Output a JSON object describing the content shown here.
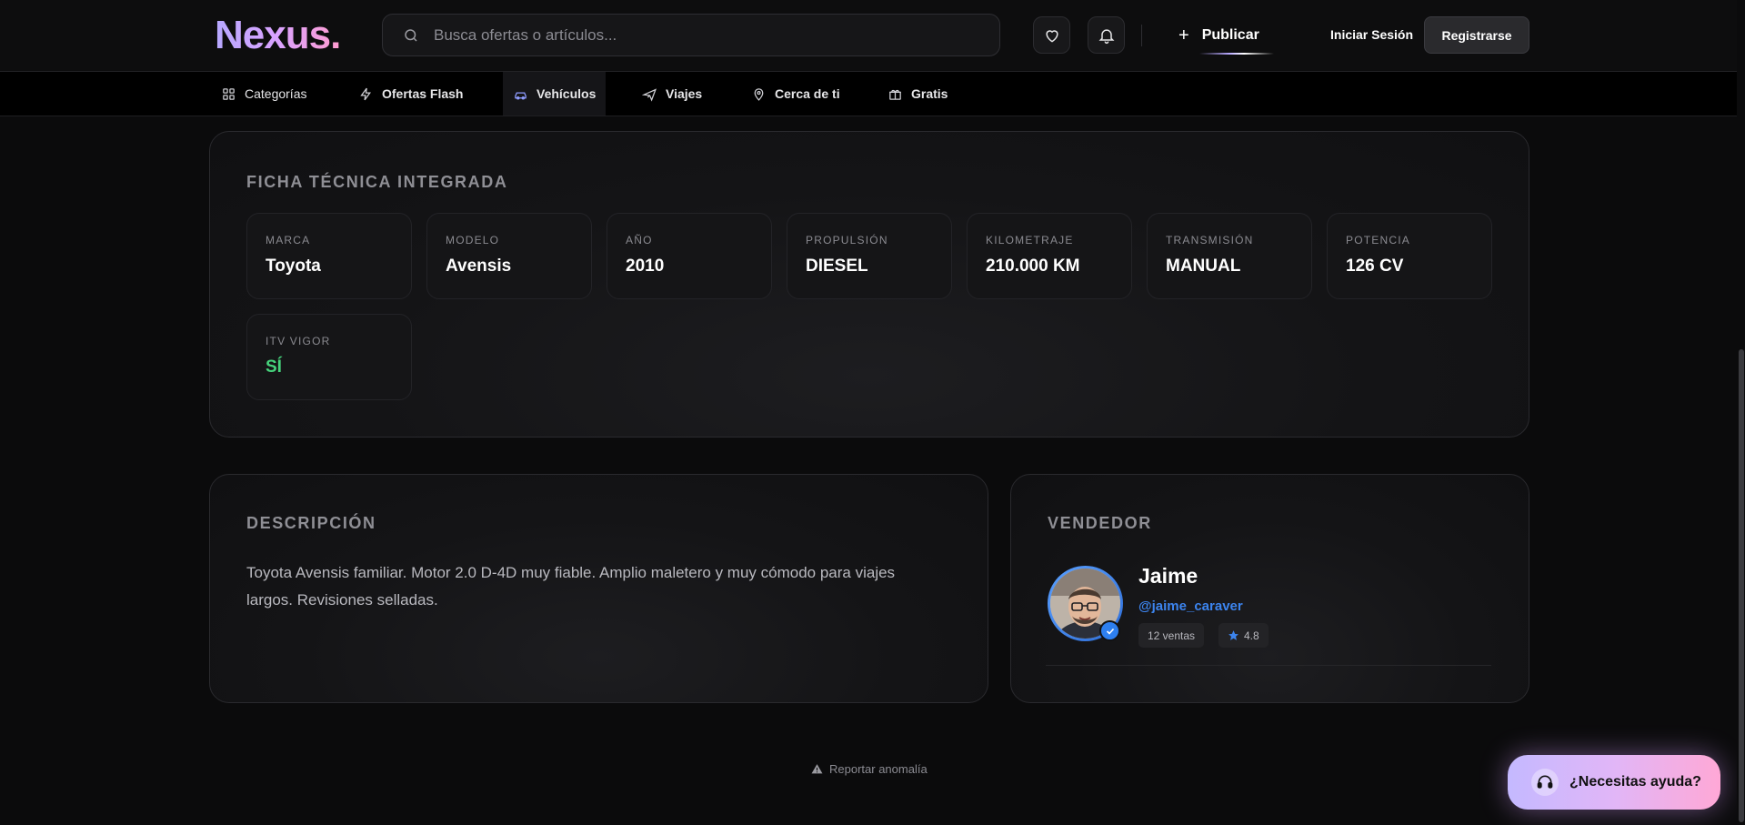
{
  "header": {
    "logo": "Nexus.",
    "search_placeholder": "Busca ofertas o artículos...",
    "favorites_icon": "heart-icon",
    "notifications_icon": "bell-icon",
    "publish_label": "Publicar",
    "login_label": "Iniciar Sesión",
    "register_label": "Registrarse"
  },
  "categories": [
    {
      "label": "Categorías",
      "icon": "grid-icon"
    },
    {
      "label": "Ofertas Flash",
      "icon": "lightning-icon"
    },
    {
      "label": "Vehículos",
      "icon": "car-icon",
      "active": true
    },
    {
      "label": "Viajes",
      "icon": "plane-icon"
    },
    {
      "label": "Cerca de ti",
      "icon": "map-pin-icon"
    },
    {
      "label": "Gratis",
      "icon": "gift-icon"
    }
  ],
  "specs": {
    "title": "FICHA TÉCNICA INTEGRADA",
    "items": [
      {
        "label": "MARCA",
        "value": "Toyota"
      },
      {
        "label": "MODELO",
        "value": "Avensis"
      },
      {
        "label": "AÑO",
        "value": "2010"
      },
      {
        "label": "PROPULSIÓN",
        "value": "DIESEL"
      },
      {
        "label": "KILOMETRAJE",
        "value": "210.000 KM"
      },
      {
        "label": "TRANSMISIÓN",
        "value": "MANUAL"
      },
      {
        "label": "POTENCIA",
        "value": "126 CV"
      },
      {
        "label": "ITV VIGOR",
        "value": "SÍ"
      }
    ]
  },
  "description": {
    "title": "DESCRIPCIÓN",
    "text": "Toyota Avensis familiar. Motor 2.0 D-4D muy fiable. Amplio maletero y muy cómodo para viajes largos. Revisiones selladas."
  },
  "seller": {
    "title": "VENDEDOR",
    "name": "Jaime",
    "handle": "@jaime_caraver",
    "sales": "12 ventas",
    "rating": "4.8"
  },
  "footer": {
    "report_label": "Reportar anomalía",
    "help_label": "¿Necesitas ayuda?"
  },
  "colors": {
    "accent_blue": "#3c84ee",
    "success_green": "#46d37c",
    "help_gradient_start": "#c4b9ff",
    "help_gradient_end": "#ffa8d6"
  }
}
